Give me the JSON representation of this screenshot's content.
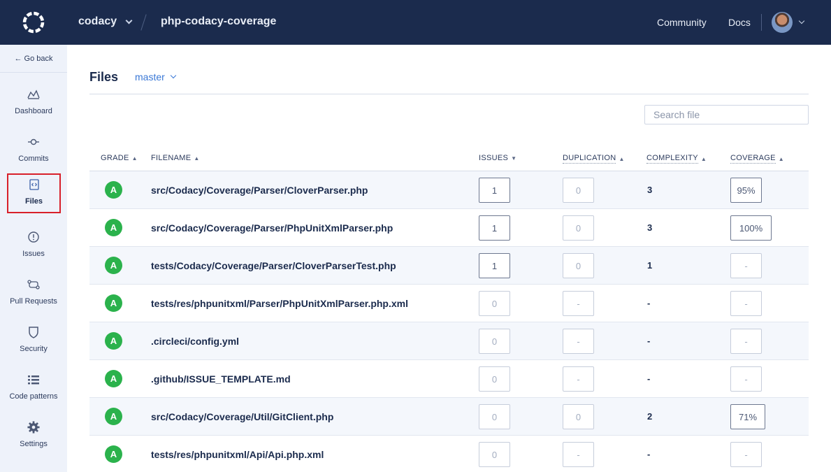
{
  "header": {
    "org": "codacy",
    "repo": "php-codacy-coverage",
    "links": [
      "Community",
      "Docs"
    ]
  },
  "sidebar": {
    "go_back": "← Go back",
    "items": [
      {
        "label": "Dashboard",
        "icon": "chart-icon"
      },
      {
        "label": "Commits",
        "icon": "commit-icon"
      },
      {
        "label": "Files",
        "icon": "file-code-icon",
        "active": true
      },
      {
        "label": "Issues",
        "icon": "alert-circle-icon"
      },
      {
        "label": "Pull Requests",
        "icon": "pull-request-icon"
      },
      {
        "label": "Security",
        "icon": "shield-icon"
      },
      {
        "label": "Code patterns",
        "icon": "list-icon"
      },
      {
        "label": "Settings",
        "icon": "gear-icon"
      }
    ]
  },
  "main": {
    "title": "Files",
    "branch": "master",
    "search_placeholder": "Search file",
    "columns": {
      "grade": "GRADE",
      "filename": "FILENAME",
      "issues": "ISSUES",
      "duplication": "DUPLICATION",
      "complexity": "COMPLEXITY",
      "coverage": "COVERAGE"
    },
    "rows": [
      {
        "grade": "A",
        "filename": "src/Codacy/Coverage/Parser/CloverParser.php",
        "issues": "1",
        "duplication": "0",
        "complexity": "3",
        "coverage": "95%"
      },
      {
        "grade": "A",
        "filename": "src/Codacy/Coverage/Parser/PhpUnitXmlParser.php",
        "issues": "1",
        "duplication": "0",
        "complexity": "3",
        "coverage": "100%"
      },
      {
        "grade": "A",
        "filename": "tests/Codacy/Coverage/Parser/CloverParserTest.php",
        "issues": "1",
        "duplication": "0",
        "complexity": "1",
        "coverage": "-"
      },
      {
        "grade": "A",
        "filename": "tests/res/phpunitxml/Parser/PhpUnitXmlParser.php.xml",
        "issues": "0",
        "duplication": "-",
        "complexity": "-",
        "coverage": "-"
      },
      {
        "grade": "A",
        "filename": ".circleci/config.yml",
        "issues": "0",
        "duplication": "-",
        "complexity": "-",
        "coverage": "-"
      },
      {
        "grade": "A",
        "filename": ".github/ISSUE_TEMPLATE.md",
        "issues": "0",
        "duplication": "-",
        "complexity": "-",
        "coverage": "-"
      },
      {
        "grade": "A",
        "filename": "src/Codacy/Coverage/Util/GitClient.php",
        "issues": "0",
        "duplication": "0",
        "complexity": "2",
        "coverage": "71%"
      },
      {
        "grade": "A",
        "filename": "tests/res/phpunitxml/Api/Api.php.xml",
        "issues": "0",
        "duplication": "-",
        "complexity": "-",
        "coverage": "-"
      }
    ]
  },
  "colors": {
    "topbar": "#1b2b4d",
    "sidebar": "#eef2fa",
    "grade_a": "#2bb24c",
    "accent_link": "#3a78d6",
    "active_outline": "#d8202a"
  }
}
